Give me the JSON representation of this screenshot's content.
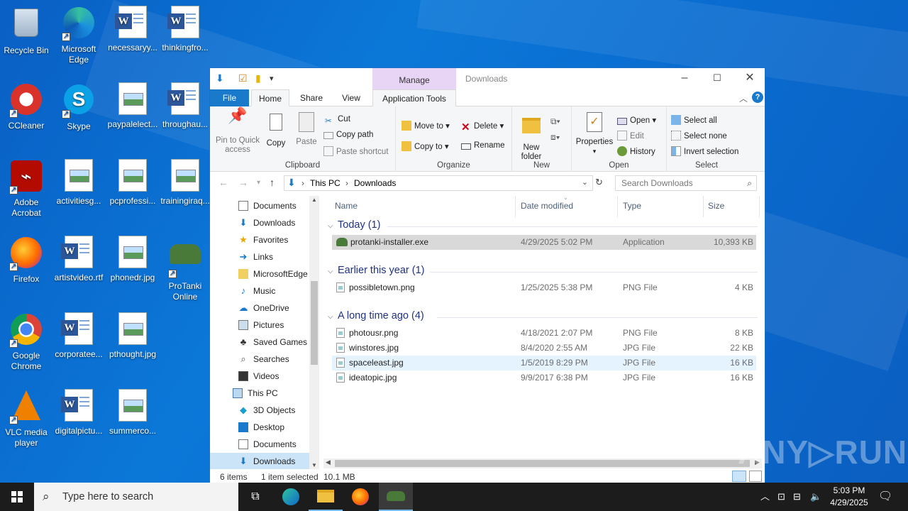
{
  "desktop": {
    "icons": [
      {
        "label": "Recycle Bin",
        "kind": "recycle-bin"
      },
      {
        "label": "Microsoft Edge",
        "kind": "edge"
      },
      {
        "label": "necessaryy...",
        "kind": "word"
      },
      {
        "label": "thinkingfro...",
        "kind": "word"
      },
      {
        "label": "CCleaner",
        "kind": "ccleaner"
      },
      {
        "label": "Skype",
        "kind": "skype"
      },
      {
        "label": "paypalelect...",
        "kind": "image"
      },
      {
        "label": "throughau...",
        "kind": "word"
      },
      {
        "label": "Adobe Acrobat",
        "kind": "acrobat"
      },
      {
        "label": "activitiesg...",
        "kind": "image"
      },
      {
        "label": "pcprofessi...",
        "kind": "image"
      },
      {
        "label": "trainingiraq...",
        "kind": "image"
      },
      {
        "label": "Firefox",
        "kind": "firefox"
      },
      {
        "label": "artistvideo.rtf",
        "kind": "word"
      },
      {
        "label": "phonedr.jpg",
        "kind": "image"
      },
      {
        "label": "ProTanki Online",
        "kind": "protanki"
      },
      {
        "label": "Google Chrome",
        "kind": "chrome"
      },
      {
        "label": "corporatee...",
        "kind": "word"
      },
      {
        "label": "pthought.jpg",
        "kind": "image"
      },
      {
        "label": "VLC media player",
        "kind": "vlc"
      },
      {
        "label": "digitalpictu...",
        "kind": "word"
      },
      {
        "label": "summerco...",
        "kind": "image"
      }
    ]
  },
  "explorer": {
    "title": "Downloads",
    "context_tab": "Manage",
    "tabs": {
      "file": "File",
      "home": "Home",
      "share": "Share",
      "view": "View",
      "app_tools": "Application Tools"
    },
    "ribbon": {
      "clipboard": {
        "label": "Clipboard",
        "pin": "Pin to Quick access",
        "copy": "Copy",
        "paste": "Paste",
        "cut": "Cut",
        "copy_path": "Copy path",
        "paste_shortcut": "Paste shortcut"
      },
      "organize": {
        "label": "Organize",
        "move_to": "Move to",
        "copy_to": "Copy to",
        "delete": "Delete",
        "rename": "Rename"
      },
      "new": {
        "label": "New",
        "new_folder": "New folder"
      },
      "open": {
        "label": "Open",
        "properties": "Properties",
        "open": "Open",
        "edit": "Edit",
        "history": "History"
      },
      "select": {
        "label": "Select",
        "select_all": "Select all",
        "select_none": "Select none",
        "invert": "Invert selection"
      }
    },
    "address": {
      "crumbs": [
        "This PC",
        "Downloads"
      ],
      "search_placeholder": "Search Downloads"
    },
    "nav": [
      {
        "label": "Documents",
        "icon": "documents-icon",
        "indent": 1
      },
      {
        "label": "Downloads",
        "icon": "downloads-icon",
        "indent": 1
      },
      {
        "label": "Favorites",
        "icon": "favorites-icon",
        "indent": 1
      },
      {
        "label": "Links",
        "icon": "links-icon",
        "indent": 1
      },
      {
        "label": "MicrosoftEdge",
        "icon": "folder-icon",
        "indent": 1
      },
      {
        "label": "Music",
        "icon": "music-icon",
        "indent": 1
      },
      {
        "label": "OneDrive",
        "icon": "onedrive-icon",
        "indent": 1
      },
      {
        "label": "Pictures",
        "icon": "pictures-icon",
        "indent": 1
      },
      {
        "label": "Saved Games",
        "icon": "saved-games-icon",
        "indent": 1
      },
      {
        "label": "Searches",
        "icon": "searches-icon",
        "indent": 1
      },
      {
        "label": "Videos",
        "icon": "videos-icon",
        "indent": 1
      },
      {
        "label": "This PC",
        "icon": "this-pc-icon",
        "indent": 0
      },
      {
        "label": "3D Objects",
        "icon": "3d-objects-icon",
        "indent": 1
      },
      {
        "label": "Desktop",
        "icon": "desktop-icon",
        "indent": 1
      },
      {
        "label": "Documents",
        "icon": "documents-icon",
        "indent": 1
      },
      {
        "label": "Downloads",
        "icon": "downloads-icon",
        "indent": 1,
        "selected": true
      }
    ],
    "columns": {
      "name": "Name",
      "date": "Date modified",
      "type": "Type",
      "size": "Size"
    },
    "groups": [
      {
        "title": "Today (1)",
        "files": [
          {
            "name": "protanki-installer.exe",
            "date": "4/29/2025 5:02 PM",
            "type": "Application",
            "size": "10,393 KB",
            "icon": "app",
            "state": "selected"
          }
        ]
      },
      {
        "title": "Earlier this year (1)",
        "files": [
          {
            "name": "possibletown.png",
            "date": "1/25/2025 5:38 PM",
            "type": "PNG File",
            "size": "4 KB",
            "icon": "image"
          }
        ]
      },
      {
        "title": "A long time ago (4)",
        "files": [
          {
            "name": "photousr.png",
            "date": "4/18/2021 2:07 PM",
            "type": "PNG File",
            "size": "8 KB",
            "icon": "image"
          },
          {
            "name": "winstores.jpg",
            "date": "8/4/2020 2:55 AM",
            "type": "JPG File",
            "size": "22 KB",
            "icon": "image"
          },
          {
            "name": "spaceleast.jpg",
            "date": "1/5/2019 8:29 PM",
            "type": "JPG File",
            "size": "16 KB",
            "icon": "image",
            "state": "hover"
          },
          {
            "name": "ideatopic.jpg",
            "date": "9/9/2017 6:38 PM",
            "type": "JPG File",
            "size": "16 KB",
            "icon": "image"
          }
        ]
      }
    ],
    "status": {
      "items": "6 items",
      "selected": "1 item selected",
      "size": "10.1 MB"
    }
  },
  "taskbar": {
    "search_placeholder": "Type here to search",
    "time": "5:03 PM",
    "date": "4/29/2025"
  },
  "watermark": "ANY▷RUN"
}
